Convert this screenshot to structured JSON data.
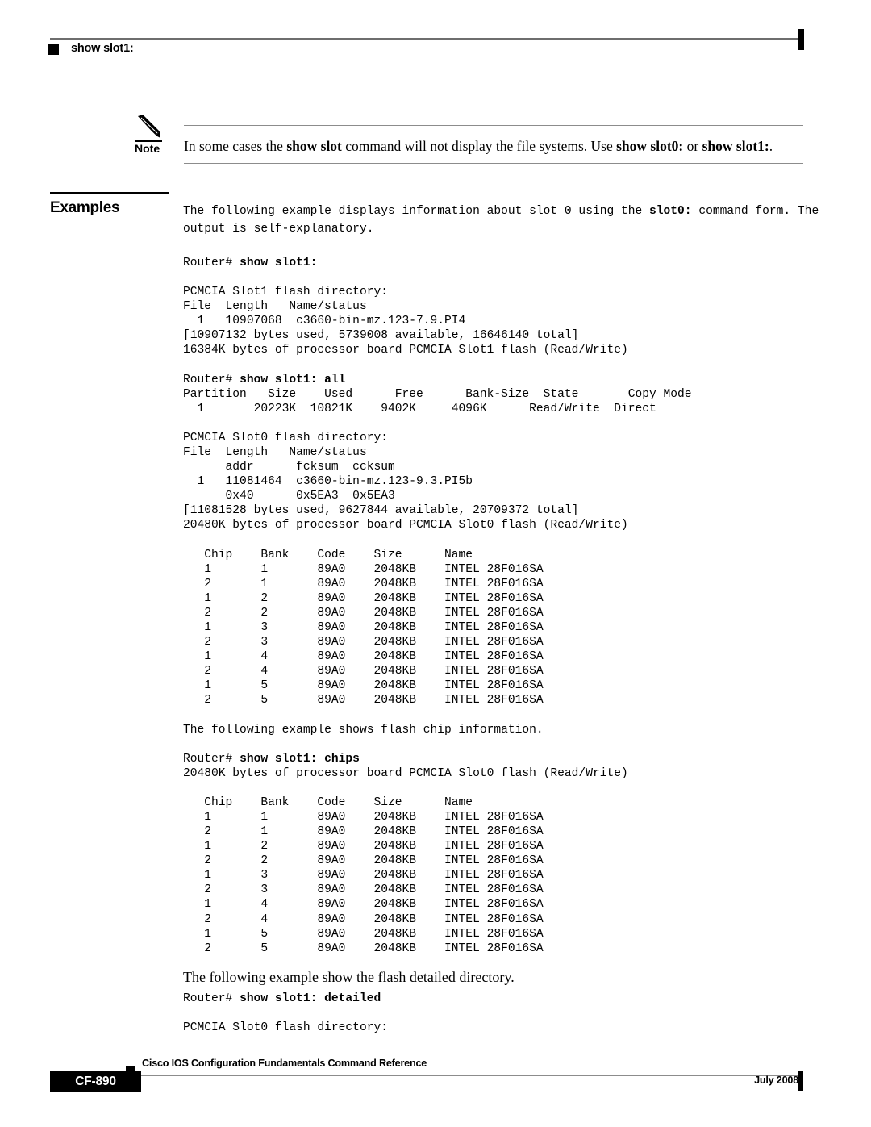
{
  "header": {
    "title": "show slot1:",
    "bullet_icon": "square-bullet-icon",
    "edge_tab_icon": "page-edge-tab-icon"
  },
  "note": {
    "icon": "pencil-icon",
    "label": "Note",
    "text_before": "In some cases the ",
    "bold_1": "show slot",
    "text_mid_1": " command will not display the file systems. Use ",
    "bold_2": "show slot0:",
    "text_mid_2": " or ",
    "bold_3": "show slot1:",
    "text_after": "."
  },
  "examples": {
    "heading": "Examples",
    "intro_before": "The following example displays information about slot 0 using the ",
    "intro_bold": "slot0:",
    "intro_after": " command form. The\noutput is self-explanatory.",
    "prompt_1": "Router# ",
    "command_1": "show slot1:",
    "output_1": "PCMCIA Slot1 flash directory:\nFile  Length   Name/status\n  1   10907068  c3660-bin-mz.123-7.9.PI4\n[10907132 bytes used, 5739008 available, 16646140 total]\n16384K bytes of processor board PCMCIA Slot1 flash (Read/Write)",
    "prompt_2": "Router# ",
    "command_2": "show slot1: all",
    "output_2": "Partition   Size    Used      Free      Bank-Size  State       Copy Mode\n  1       20223K  10821K    9402K     4096K      Read/Write  Direct",
    "output_3": "PCMCIA Slot0 flash directory:\nFile  Length   Name/status\n      addr      fcksum  ccksum\n  1   11081464  c3660-bin-mz.123-9.3.PI5b\n      0x40      0x5EA3  0x5EA3\n[11081528 bytes used, 9627844 available, 20709372 total]\n20480K bytes of processor board PCMCIA Slot0 flash (Read/Write)",
    "chips_intro": "The following example shows flash chip information.",
    "prompt_3": "Router# ",
    "command_3": "show slot1: chips",
    "chips_banner": "20480K bytes of processor board PCMCIA Slot0 flash (Read/Write)",
    "detailed_intro": "The following example show the flash detailed directory.",
    "prompt_4": "Router# ",
    "command_4": "show slot1: detailed",
    "output_4": "PCMCIA Slot0 flash directory:"
  },
  "chip_table": {
    "headers": [
      "Chip",
      "Bank",
      "Code",
      "Size",
      "Name"
    ],
    "rows": [
      [
        "1",
        "1",
        "89A0",
        "2048KB",
        "INTEL 28F016SA"
      ],
      [
        "2",
        "1",
        "89A0",
        "2048KB",
        "INTEL 28F016SA"
      ],
      [
        "1",
        "2",
        "89A0",
        "2048KB",
        "INTEL 28F016SA"
      ],
      [
        "2",
        "2",
        "89A0",
        "2048KB",
        "INTEL 28F016SA"
      ],
      [
        "1",
        "3",
        "89A0",
        "2048KB",
        "INTEL 28F016SA"
      ],
      [
        "2",
        "3",
        "89A0",
        "2048KB",
        "INTEL 28F016SA"
      ],
      [
        "1",
        "4",
        "89A0",
        "2048KB",
        "INTEL 28F016SA"
      ],
      [
        "2",
        "4",
        "89A0",
        "2048KB",
        "INTEL 28F016SA"
      ],
      [
        "1",
        "5",
        "89A0",
        "2048KB",
        "INTEL 28F016SA"
      ],
      [
        "2",
        "5",
        "89A0",
        "2048KB",
        "INTEL 28F016SA"
      ]
    ]
  },
  "footer": {
    "document_title": "Cisco IOS Configuration Fundamentals Command Reference",
    "page_number": "CF-890",
    "date": "July 2008"
  }
}
